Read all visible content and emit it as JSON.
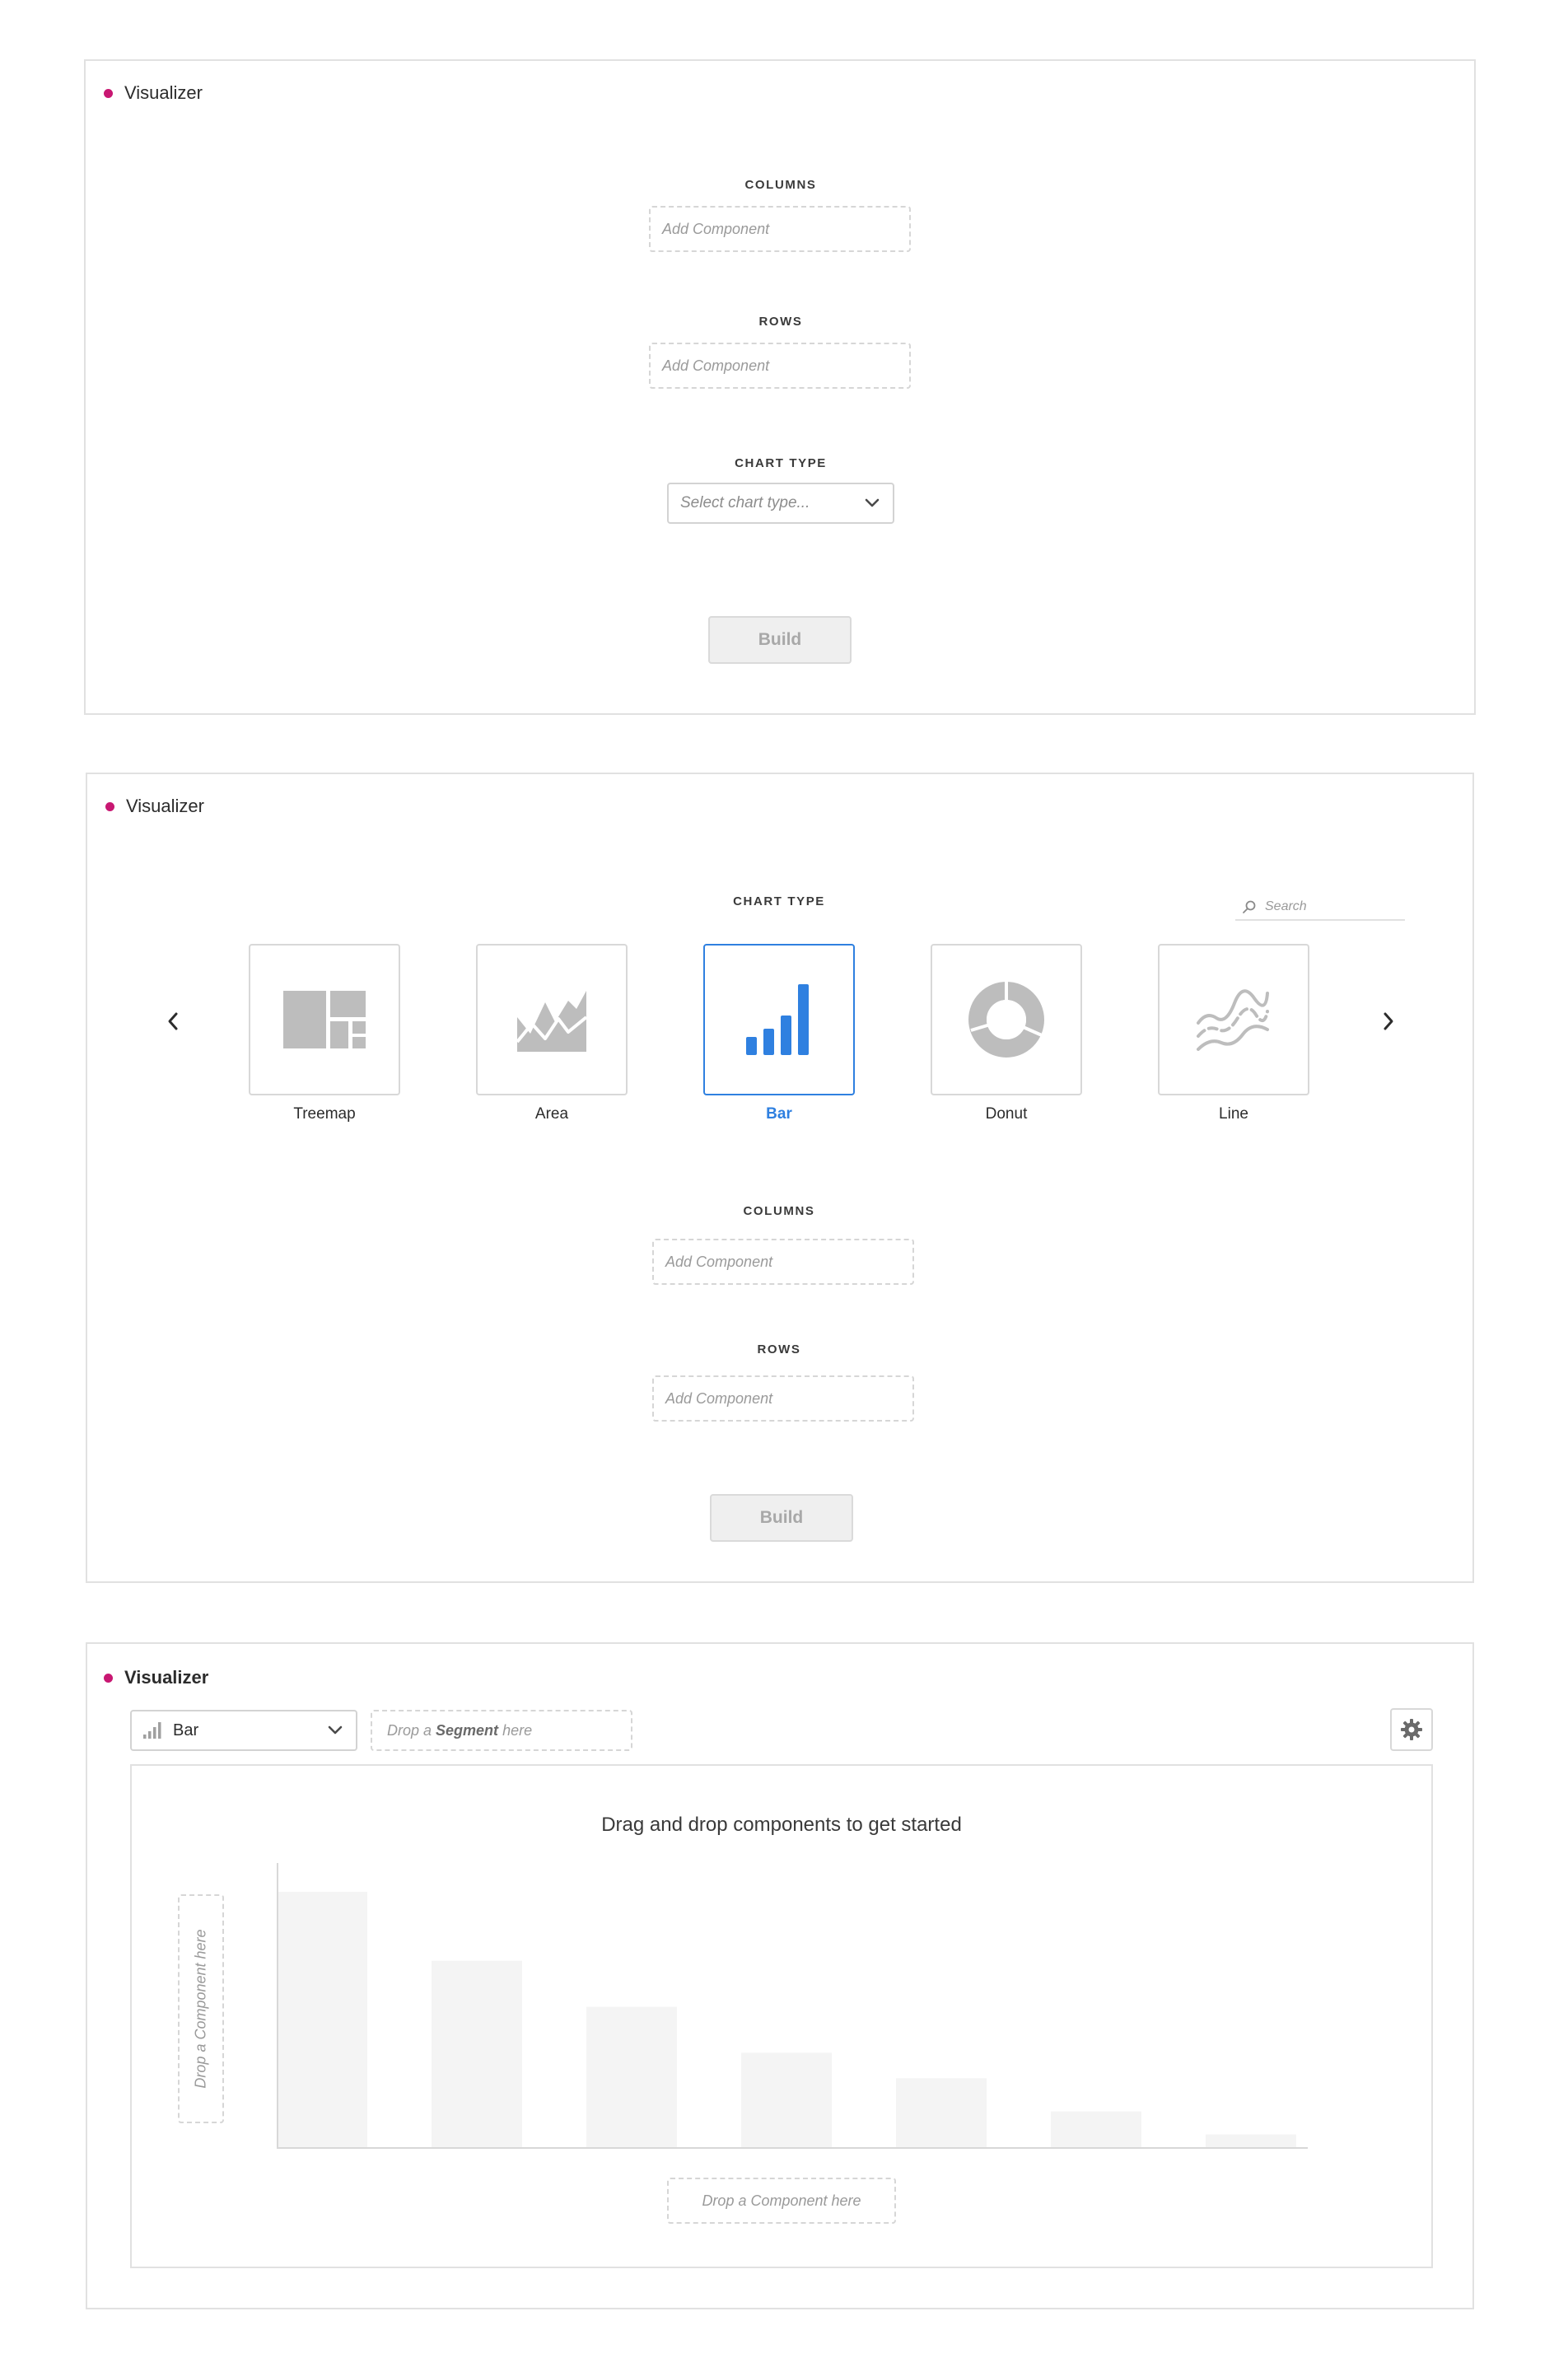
{
  "panel1": {
    "title": "Visualizer",
    "columns_label": "COLUMNS",
    "columns_placeholder": "Add Component",
    "rows_label": "ROWS",
    "rows_placeholder": "Add Component",
    "chart_type_label": "CHART TYPE",
    "chart_type_placeholder": "Select chart type...",
    "build_label": "Build"
  },
  "panel2": {
    "title": "Visualizer",
    "chart_type_label": "CHART TYPE",
    "search_placeholder": "Search",
    "tiles": [
      {
        "label": "Treemap",
        "icon": "treemap-icon"
      },
      {
        "label": "Area",
        "icon": "area-chart-icon"
      },
      {
        "label": "Bar",
        "icon": "bar-chart-icon",
        "selected": true
      },
      {
        "label": "Donut",
        "icon": "donut-chart-icon"
      },
      {
        "label": "Line",
        "icon": "line-chart-icon"
      }
    ],
    "columns_label": "COLUMNS",
    "columns_placeholder": "Add Component",
    "rows_label": "ROWS",
    "rows_placeholder": "Add Component",
    "build_label": "Build"
  },
  "panel3": {
    "title": "Visualizer",
    "chart_select_value": "Bar",
    "segment_prefix": "Drop a",
    "segment_bold": "Segment",
    "segment_suffix": "here",
    "canvas_title": "Drag and drop components to get started",
    "y_dropzone": "Drop a Component here",
    "x_dropzone": "Drop a Component here",
    "placeholder_bars": [
      100,
      73,
      55,
      37,
      27,
      14,
      5
    ]
  },
  "colors": {
    "accent_dot": "#c81772",
    "selected_blue": "#2f80e0",
    "icon_gray": "#bdbdbd",
    "placeholder_bar": "#f4f4f4"
  }
}
